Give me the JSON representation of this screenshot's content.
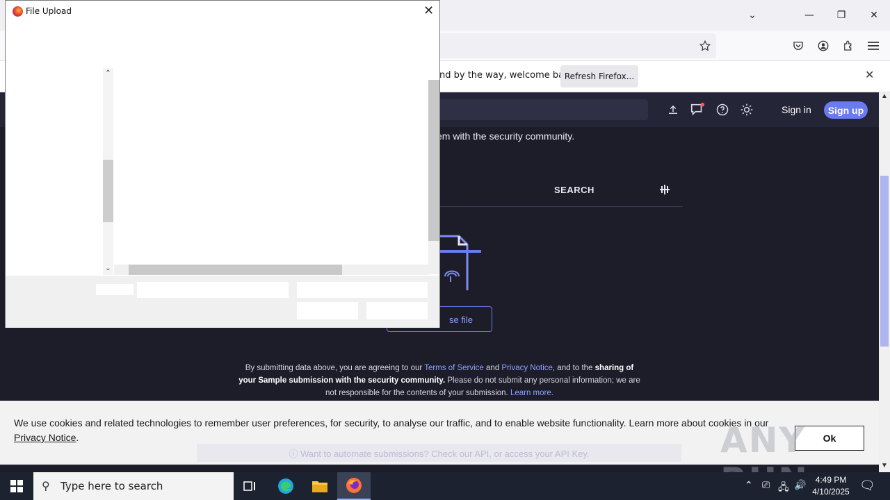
{
  "browser": {
    "notification": {
      "message": "nd by the way, welcome back!",
      "button_label": "Refresh Firefox..."
    },
    "icons": [
      "chevron-down-icon",
      "minimize-icon",
      "restore-icon",
      "close-icon",
      "bookmark-star-icon",
      "pocket-icon",
      "account-icon",
      "extensions-icon",
      "menu-icon"
    ]
  },
  "site": {
    "signin_label": "Sign in",
    "signup_label": "Sign up",
    "subtitle": "em with the security community.",
    "search_tab": "SEARCH",
    "choose_file_label": "se file",
    "terms": {
      "p1": "By submitting data above, you are agreeing to our ",
      "tos": "Terms of Service",
      "and": " and ",
      "privacy": "Privacy Notice",
      "p2": ", and to the ",
      "sharing": "sharing of your Sample submission with the security community.",
      "p3": " Please do not submit any personal information; we are not responsible for the contents of your submission. ",
      "learn_more": "Learn more."
    }
  },
  "cookie": {
    "text": "We use cookies and related technologies to remember user preferences, for security, to analyse our traffic, and to enable website functionality. Learn more about cookies in our ",
    "link": "Privacy Notice",
    "end": ".",
    "ok_label": "Ok",
    "api_strip": "ⓘ Want to automate submissions? Check our API, or access your API Key."
  },
  "watermark": "ANY RUN",
  "dialog": {
    "title": "File Upload"
  },
  "taskbar": {
    "search_placeholder": "Type here to search",
    "time": "4:49 PM",
    "date": "4/10/2025"
  }
}
